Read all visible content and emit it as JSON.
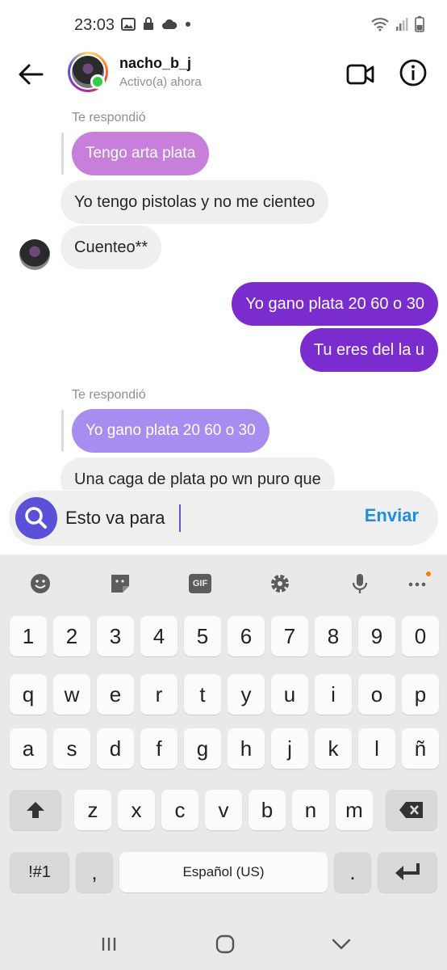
{
  "status_bar": {
    "time": "23:03",
    "icons": [
      "image-icon",
      "lock-icon",
      "cloud-icon",
      "dot-icon",
      "wifi-icon",
      "signal-icon",
      "battery-icon"
    ]
  },
  "header": {
    "username": "nacho_b_j",
    "activity": "Activo(a) ahora"
  },
  "messages": [
    {
      "type": "reply_label",
      "text": "Te respondió"
    },
    {
      "type": "quoted",
      "text": "Tengo arta plata"
    },
    {
      "type": "received",
      "text": "Yo tengo pistolas y no me cienteo"
    },
    {
      "type": "received",
      "text": "Cuenteo**"
    },
    {
      "type": "sent",
      "text": "Yo gano plata 20 60 o 30"
    },
    {
      "type": "sent",
      "text": "Tu eres del la u"
    },
    {
      "type": "reply_label",
      "text": "Te respondió"
    },
    {
      "type": "quoted",
      "text": "Yo gano plata 20 60 o 30"
    },
    {
      "type": "received",
      "text": "Una caga de plata po wn puro que"
    }
  ],
  "composer": {
    "value": "Esto va para",
    "send_label": "Enviar"
  },
  "keyboard": {
    "toolbar": [
      "emoji-icon",
      "sticker-icon",
      "gif-icon",
      "settings-icon",
      "mic-icon",
      "more-icon"
    ],
    "gif_label": "GIF",
    "rows": [
      [
        "1",
        "2",
        "3",
        "4",
        "5",
        "6",
        "7",
        "8",
        "9",
        "0"
      ],
      [
        "q",
        "w",
        "e",
        "r",
        "t",
        "y",
        "u",
        "i",
        "o",
        "p"
      ],
      [
        "a",
        "s",
        "d",
        "f",
        "g",
        "h",
        "j",
        "k",
        "l",
        "ñ"
      ],
      [
        "z",
        "x",
        "c",
        "v",
        "b",
        "n",
        "m"
      ]
    ],
    "symbols_label": "!#1",
    "comma": ",",
    "space_label": "Español (US)",
    "period": "."
  },
  "navbar": [
    "recents-icon",
    "home-icon",
    "back-chevron-icon"
  ]
}
